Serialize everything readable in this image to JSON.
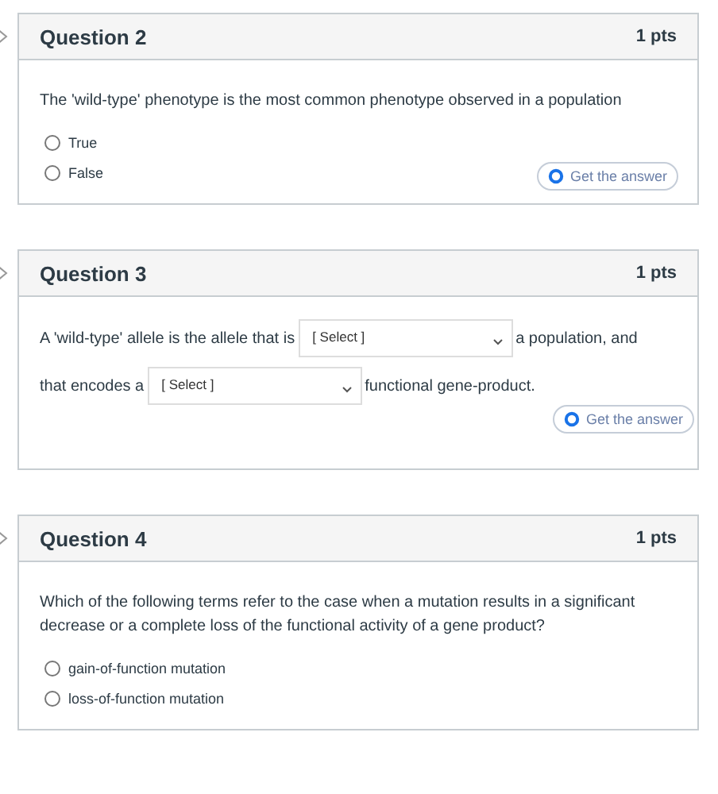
{
  "questions": [
    {
      "kind": "choice",
      "title": "Question 2",
      "points": "1 pts",
      "text": "The 'wild-type' phenotype is the most common phenotype observed in a population",
      "options": [
        {
          "label": "True",
          "selected": false
        },
        {
          "label": "False",
          "selected": false
        }
      ],
      "help_button": "Get the answer"
    },
    {
      "kind": "dropdowns",
      "title": "Question 3",
      "points": "1 pts",
      "lines": [
        [
          {
            "kind": "text",
            "text": "A 'wild-type' allele is the allele that is"
          },
          {
            "kind": "select",
            "text": "[ Select ]"
          },
          {
            "kind": "text",
            "text": "a population, and"
          }
        ],
        [
          {
            "kind": "text",
            "text": "that encodes a"
          },
          {
            "kind": "select",
            "text": "[ Select ]"
          },
          {
            "kind": "text",
            "text": "functional gene-product."
          }
        ]
      ],
      "help_button": "Get the answer"
    },
    {
      "kind": "choice",
      "title": "Question 4",
      "points": "1 pts",
      "text": "Which of the following terms refer to the case when a mutation results in a significant decrease or a complete loss of the functional activity of a gene product?",
      "options": [
        {
          "label": "gain-of-function mutation",
          "selected": false
        },
        {
          "label": "loss-of-function mutation",
          "selected": false
        }
      ]
    }
  ]
}
